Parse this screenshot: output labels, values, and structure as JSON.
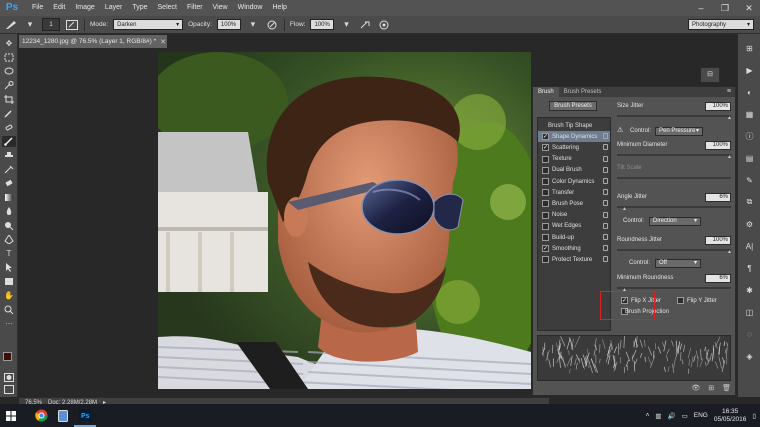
{
  "app": {
    "logo": "Ps"
  },
  "menu": [
    "File",
    "Edit",
    "Image",
    "Layer",
    "Type",
    "Select",
    "Filter",
    "View",
    "Window",
    "Help"
  ],
  "window_controls": {
    "minimize": "–",
    "restore": "❐",
    "close": "✕"
  },
  "options_bar": {
    "brush_size": "1",
    "mode_label": "Mode:",
    "mode_value": "Darken",
    "opacity_label": "Opacity:",
    "opacity_value": "100%",
    "flow_label": "Flow:",
    "flow_value": "100%",
    "workspace": "Photography"
  },
  "document": {
    "tab_title": "12234_1280.jpg @ 76.5% (Layer 1, RGB/8#) *",
    "zoom": "76.5%",
    "doc_size": "Doc: 2.28M/2.28M"
  },
  "brush_panel": {
    "tabs": [
      "Brush",
      "Brush Presets"
    ],
    "presets_button": "Brush Presets",
    "categories": [
      {
        "label": "Brush Tip Shape",
        "header": true,
        "checked": null,
        "selected": false
      },
      {
        "label": "Shape Dynamics",
        "header": false,
        "checked": true,
        "selected": true
      },
      {
        "label": "Scattering",
        "header": false,
        "checked": true,
        "selected": false
      },
      {
        "label": "Texture",
        "header": false,
        "checked": false,
        "selected": false
      },
      {
        "label": "Dual Brush",
        "header": false,
        "checked": false,
        "selected": false
      },
      {
        "label": "Color Dynamics",
        "header": false,
        "checked": false,
        "selected": false
      },
      {
        "label": "Transfer",
        "header": false,
        "checked": false,
        "selected": false
      },
      {
        "label": "Brush Pose",
        "header": false,
        "checked": false,
        "selected": false
      },
      {
        "label": "Noise",
        "header": false,
        "checked": false,
        "selected": false
      },
      {
        "label": "Wet Edges",
        "header": false,
        "checked": false,
        "selected": false
      },
      {
        "label": "Build-up",
        "header": false,
        "checked": false,
        "selected": false
      },
      {
        "label": "Smoothing",
        "header": false,
        "checked": true,
        "selected": false
      },
      {
        "label": "Protect Texture",
        "header": false,
        "checked": false,
        "selected": false
      }
    ],
    "size_jitter_label": "Size Jitter",
    "size_jitter_value": "100%",
    "control_label": "Control:",
    "control_value_1": "Pen Pressure",
    "min_diameter_label": "Minimum Diameter",
    "min_diameter_value": "100%",
    "tilt_scale_label": "Tilt Scale",
    "angle_jitter_label": "Angle Jitter",
    "angle_jitter_value": "6%",
    "control_value_2": "Direction",
    "roundness_jitter_label": "Roundness Jitter",
    "roundness_jitter_value": "100%",
    "control_value_3": "Off",
    "min_roundness_label": "Minimum Roundness",
    "min_roundness_value": "6%",
    "flip_x_label": "Flip X Jitter",
    "flip_x_checked": true,
    "flip_y_label": "Flip Y Jitter",
    "flip_y_checked": false,
    "brush_projection_label": "Brush Projection",
    "brush_projection_checked": false
  },
  "taskbar": {
    "language": "ENG",
    "time": "16:35",
    "date": "05/05/2016"
  },
  "colors": {
    "foreground": "#3a0f0a",
    "background": "#ffffff",
    "accent": "#31a8ff",
    "highlight": "#e02020"
  }
}
